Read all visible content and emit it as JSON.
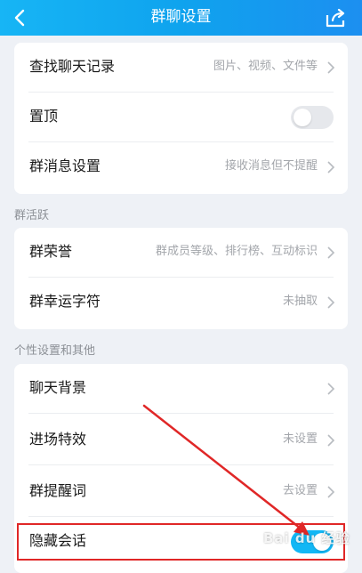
{
  "header": {
    "title": "群聊设置",
    "back_icon": "chevron-left-icon",
    "share_icon": "share-icon"
  },
  "card1": {
    "rows": [
      {
        "label": "查找聊天记录",
        "value": "图片、视频、文件等"
      },
      {
        "label": "置顶",
        "toggle": false
      },
      {
        "label": "群消息设置",
        "value": "接收消息但不提醒"
      }
    ]
  },
  "section2": {
    "title": "群活跃",
    "rows": [
      {
        "label": "群荣誉",
        "value": "群成员等级、排行榜、互动标识"
      },
      {
        "label": "群幸运字符",
        "value": "未抽取"
      }
    ]
  },
  "section3": {
    "title": "个性设置和其他",
    "rows": [
      {
        "label": "聊天背景",
        "value": ""
      },
      {
        "label": "进场特效",
        "value": "未设置"
      },
      {
        "label": "群提醒词",
        "value": "去设置"
      },
      {
        "label": "隐藏会话",
        "toggle": true
      }
    ]
  },
  "watermark": {
    "text": "Bai du 经验"
  },
  "colors": {
    "header_start": "#17b5f5",
    "header_end": "#1c8ff0",
    "toggle_on": "#12b7f5",
    "annotation_red": "#e02727"
  }
}
